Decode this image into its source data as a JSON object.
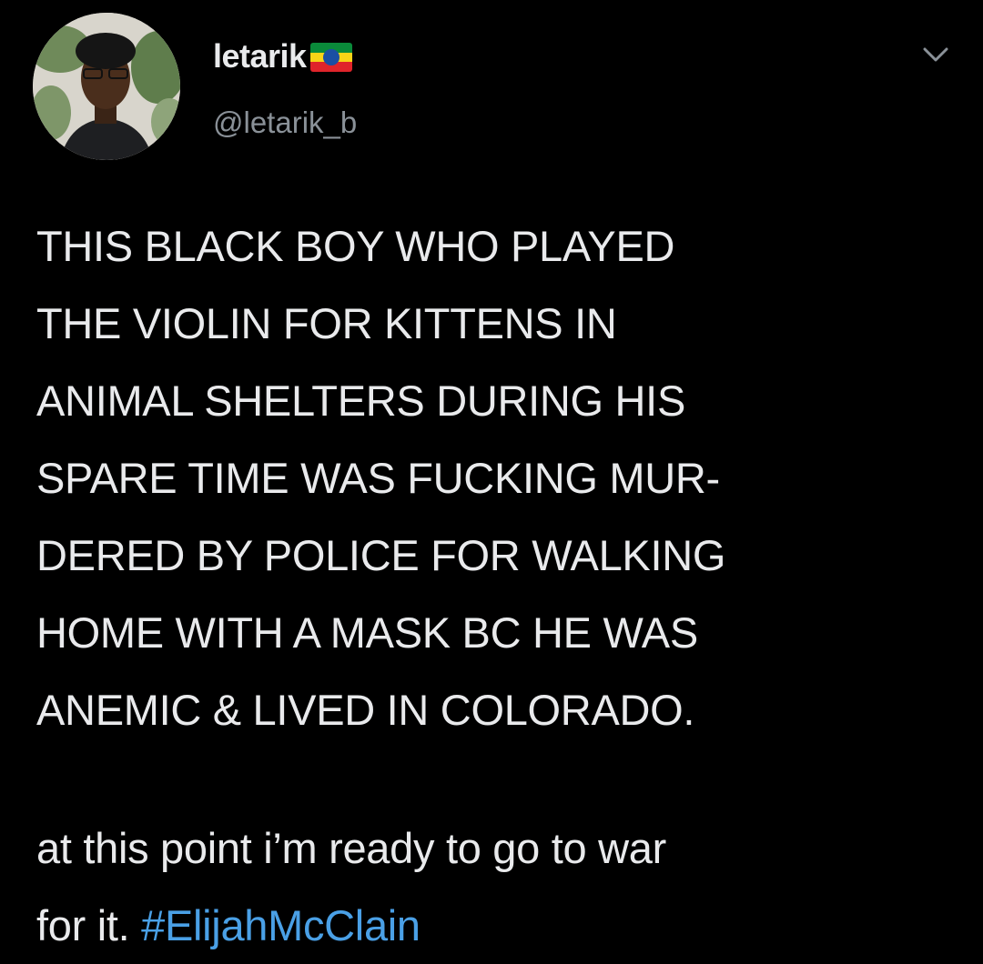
{
  "author": {
    "display_name": "letarik",
    "handle": "@letarik_b",
    "flag_icon": "ethiopia-flag-icon",
    "flag_colors": [
      "#0a8a3a",
      "#f7d417",
      "#e0242a"
    ]
  },
  "tweet": {
    "lines": [
      "THIS BLACK BOY WHO PLAYED",
      "THE VIOLIN FOR KITTENS IN",
      "ANIMAL SHELTERS DURING HIS",
      "SPARE TIME WAS FUCKING MUR-",
      "DERED BY POLICE FOR WALKING",
      "HOME WITH A MASK BC HE WAS",
      "ANEMIC & LIVED IN COLORADO."
    ],
    "tail_line_1": "at this point i’m ready to go to war",
    "tail_line_2_prefix": "for it. ",
    "hashtag": "#ElijahMcClain"
  },
  "colors": {
    "background": "#000000",
    "text": "#e9eaec",
    "secondary_text": "#8a9198",
    "hashtag": "#4aa0e6"
  }
}
